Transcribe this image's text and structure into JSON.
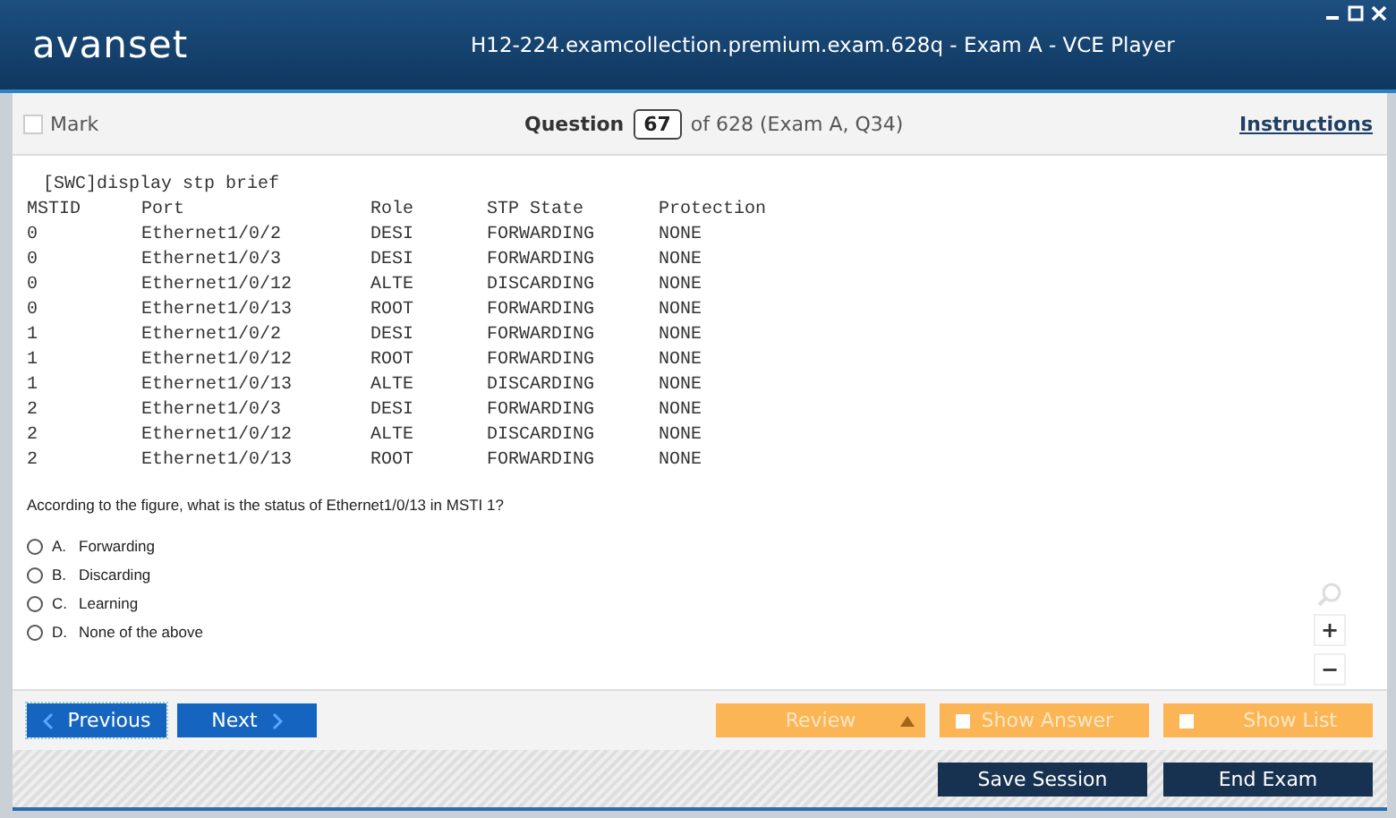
{
  "window": {
    "logo": "avanset",
    "title": "H12-224.examcollection.premium.exam.628q - Exam A - VCE Player"
  },
  "header": {
    "mark": {
      "label": "Mark",
      "checked": false
    },
    "question_label": "Question",
    "question_number": "67",
    "question_of": "of 628 (Exam A, Q34)",
    "instructions": "Instructions"
  },
  "terminal": {
    "command": "[SWC]display stp brief",
    "columns": [
      "MSTID",
      "Port",
      "Role",
      "STP State",
      "Protection"
    ],
    "rows": [
      [
        "0",
        "Ethernet1/0/2",
        "DESI",
        "FORWARDING",
        "NONE"
      ],
      [
        "0",
        "Ethernet1/0/3",
        "DESI",
        "FORWARDING",
        "NONE"
      ],
      [
        "0",
        "Ethernet1/0/12",
        "ALTE",
        "DISCARDING",
        "NONE"
      ],
      [
        "0",
        "Ethernet1/0/13",
        "ROOT",
        "FORWARDING",
        "NONE"
      ],
      [
        "1",
        "Ethernet1/0/2",
        "DESI",
        "FORWARDING",
        "NONE"
      ],
      [
        "1",
        "Ethernet1/0/12",
        "ROOT",
        "FORWARDING",
        "NONE"
      ],
      [
        "1",
        "Ethernet1/0/13",
        "ALTE",
        "DISCARDING",
        "NONE"
      ],
      [
        "2",
        "Ethernet1/0/3",
        "DESI",
        "FORWARDING",
        "NONE"
      ],
      [
        "2",
        "Ethernet1/0/12",
        "ALTE",
        "DISCARDING",
        "NONE"
      ],
      [
        "2",
        "Ethernet1/0/13",
        "ROOT",
        "FORWARDING",
        "NONE"
      ]
    ]
  },
  "question": "According to the figure, what is the status of Ethernet1/0/13 in MSTI 1?",
  "options": [
    {
      "letter": "A.",
      "text": "Forwarding",
      "selected": false
    },
    {
      "letter": "B.",
      "text": "Discarding",
      "selected": false
    },
    {
      "letter": "C.",
      "text": "Learning",
      "selected": false
    },
    {
      "letter": "D.",
      "text": "None of the above",
      "selected": false
    }
  ],
  "zoom": {
    "plus": "+",
    "minus": "−"
  },
  "nav": {
    "previous": "Previous",
    "next": "Next",
    "review": "Review",
    "show_answer": {
      "label": "Show Answer",
      "checked": false
    },
    "show_list": {
      "label": "Show List",
      "checked": false
    }
  },
  "footer": {
    "save": "Save Session",
    "end": "End Exam"
  }
}
